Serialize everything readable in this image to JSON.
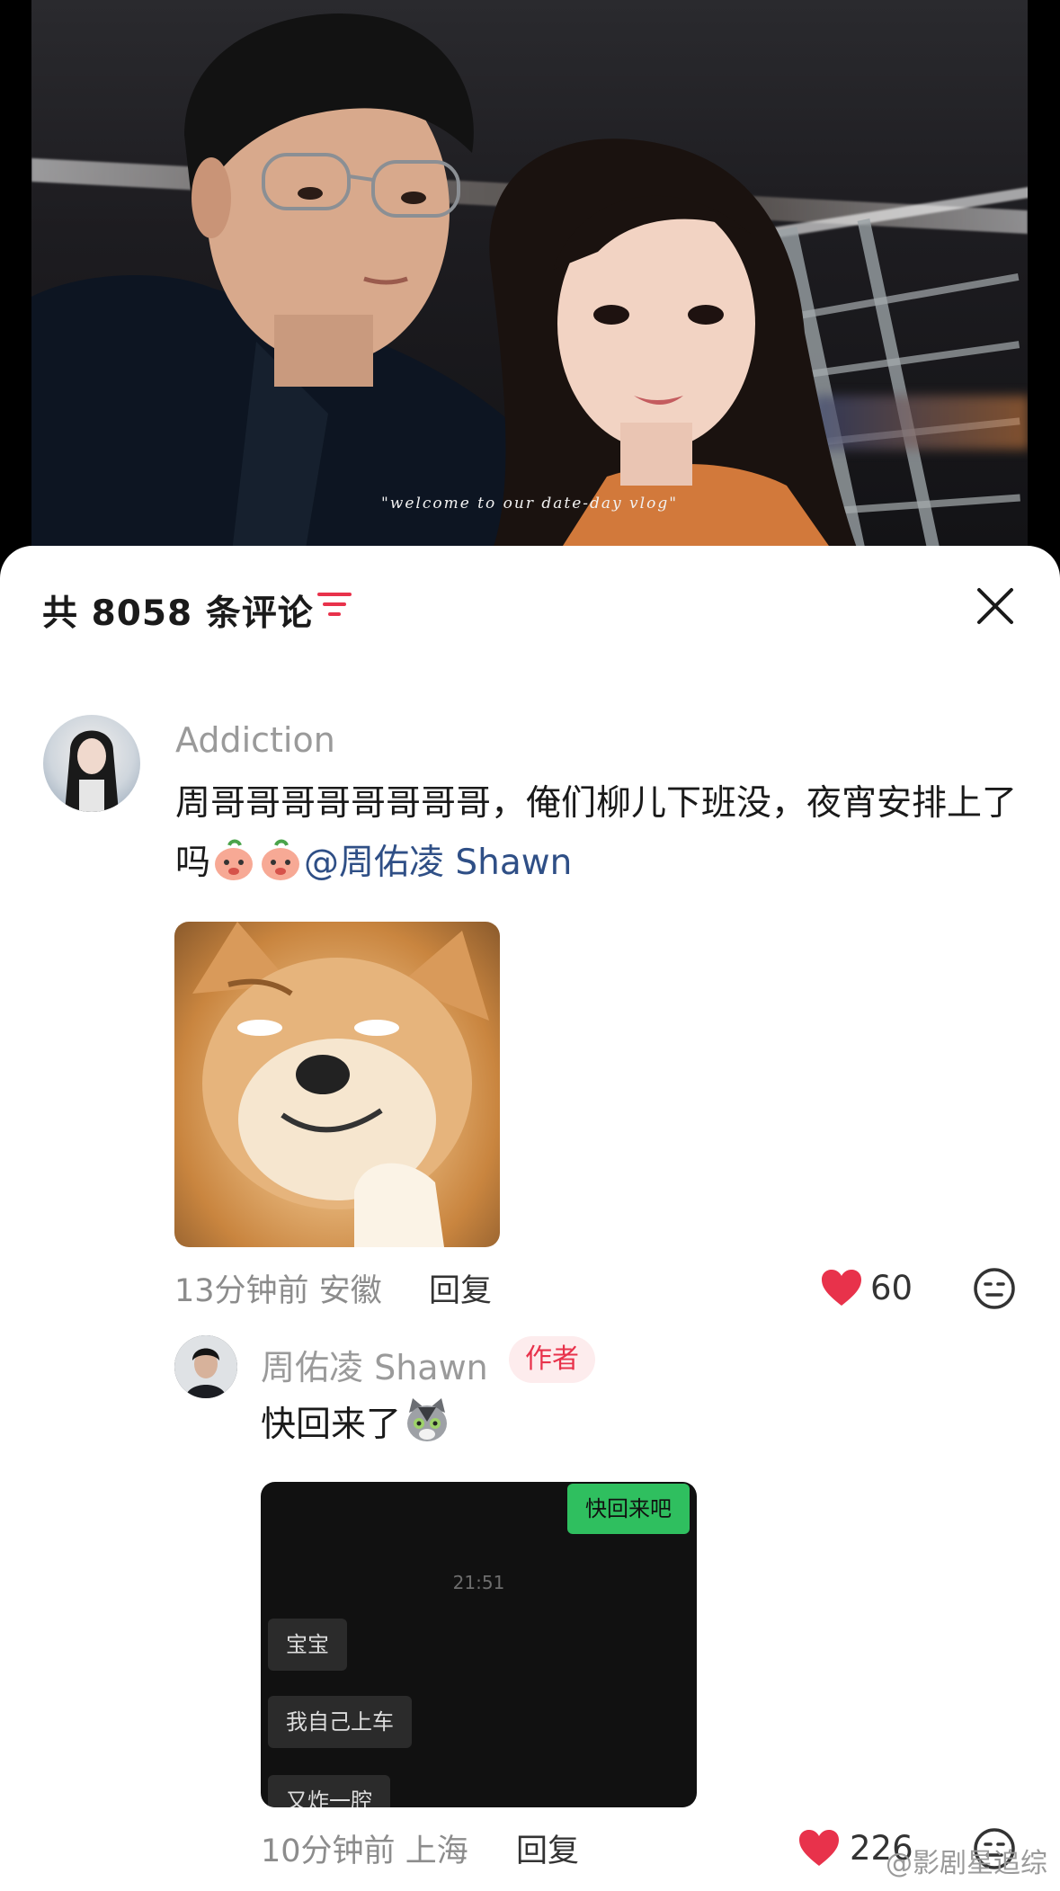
{
  "video": {
    "caption": "\"welcome to our date-day vlog\""
  },
  "comments_panel": {
    "title": "共 8058 条评论",
    "colors": {
      "accent": "#e8324b",
      "mention": "#2f4f86",
      "chat_green": "#2fbf5f"
    }
  },
  "comment1": {
    "username": "Addiction",
    "text_main": "周哥哥哥哥哥哥哥哥，俺们柳儿下班没，夜宵安排上了吗",
    "mention": "@周佑凌 Shawn",
    "time": "13分钟前",
    "location": "安徽",
    "reply_label": "回复",
    "likes": "60"
  },
  "reply1": {
    "username": "周佑凌 Shawn",
    "badge": "作者",
    "text": "快回来了",
    "chat_image": {
      "sent_message": "快回来吧",
      "time": "21:51",
      "messages": [
        "宝宝",
        "我自己上车",
        "又炸一腔"
      ]
    },
    "time": "10分钟前",
    "location": "上海",
    "reply_label": "回复",
    "likes": "226"
  },
  "watermark": "@影剧星追综"
}
